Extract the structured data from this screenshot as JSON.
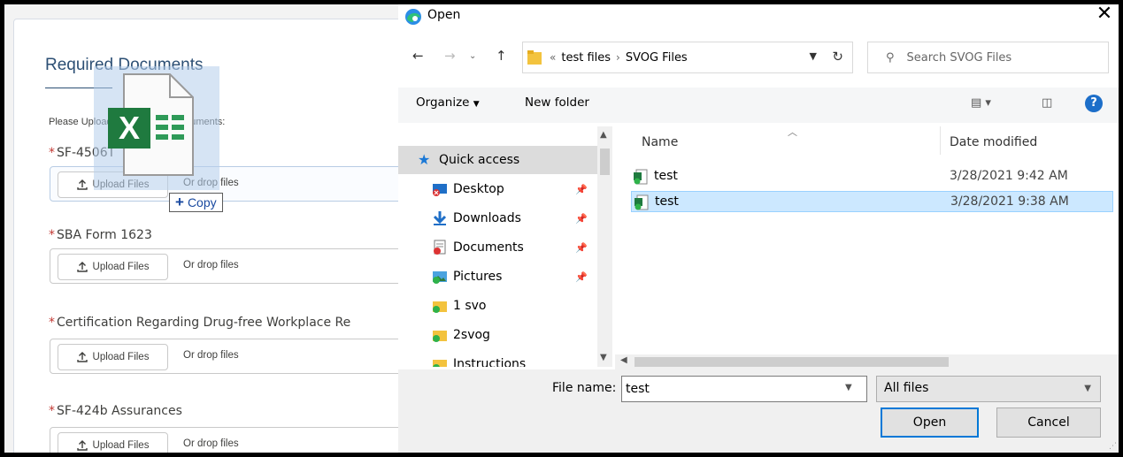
{
  "page": {
    "heading": "Required Documents",
    "instructions": "Please Upload the Following documents:",
    "upload_label": "Upload Files",
    "drop_label": "Or drop files",
    "required_marker": "*",
    "documents": [
      {
        "label": "SF-4506T"
      },
      {
        "label": "SBA Form 1623"
      },
      {
        "label": "Certification Regarding Drug-free Workplace Re"
      },
      {
        "label": "SF-424b Assurances"
      }
    ],
    "drag": {
      "copy_label": "Copy",
      "file_type_icon": "excel-file-icon"
    }
  },
  "dialog": {
    "title": "Open",
    "address": {
      "prefix": "«",
      "parts": [
        "test files",
        "SVOG Files"
      ]
    },
    "search_placeholder": "Search SVOG Files",
    "toolbar": {
      "organize": "Organize",
      "new_folder": "New folder"
    },
    "nav": [
      {
        "label": "Quick access",
        "icon": "star-icon",
        "pinned": false,
        "selected": true
      },
      {
        "label": "Desktop",
        "icon": "desktop-icon",
        "pinned": true
      },
      {
        "label": "Downloads",
        "icon": "download-icon",
        "pinned": true
      },
      {
        "label": "Documents",
        "icon": "documents-icon",
        "pinned": true
      },
      {
        "label": "Pictures",
        "icon": "pictures-icon",
        "pinned": true
      },
      {
        "label": "1 svo",
        "icon": "folder-icon",
        "pinned": false
      },
      {
        "label": "2svog",
        "icon": "folder-icon",
        "pinned": false
      },
      {
        "label": "Instructions",
        "icon": "folder-icon",
        "pinned": false
      }
    ],
    "columns": {
      "name": "Name",
      "date": "Date modified"
    },
    "files": [
      {
        "name": "test",
        "date": "3/28/2021 9:42 AM",
        "selected": false
      },
      {
        "name": "test",
        "date": "3/28/2021 9:38 AM",
        "selected": true
      }
    ],
    "file_name_label": "File name:",
    "file_name_value": "test",
    "filter_value": "All files",
    "open_label": "Open",
    "cancel_label": "Cancel"
  }
}
